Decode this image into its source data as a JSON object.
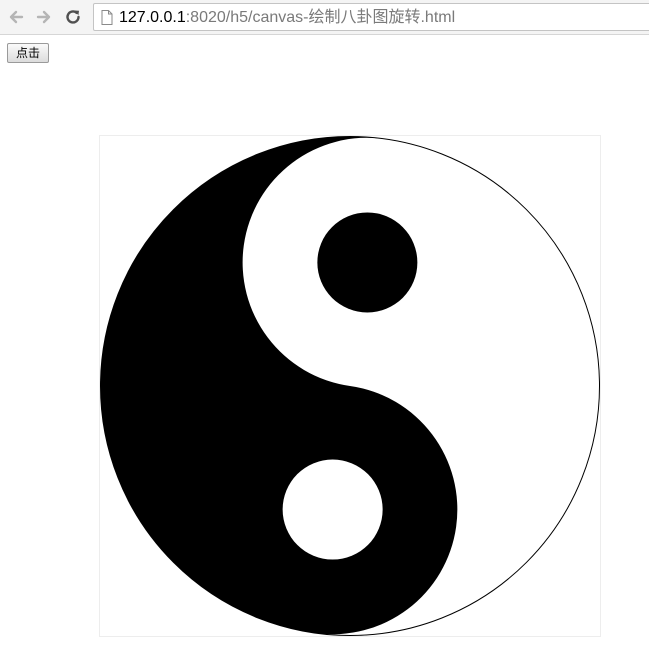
{
  "browser": {
    "url_host": "127.0.0.1",
    "url_rest": ":8020/h5/canvas-绘制八卦图旋转.html",
    "back_icon": "arrow-left-icon",
    "forward_icon": "arrow-right-icon",
    "reload_icon": "reload-icon",
    "page_icon": "document-icon"
  },
  "page": {
    "button_label": "点击"
  },
  "canvas": {
    "symbol": "yin-yang-icon",
    "dark_color": "#000000",
    "light_color": "#ffffff",
    "rotation_degrees": 0
  }
}
